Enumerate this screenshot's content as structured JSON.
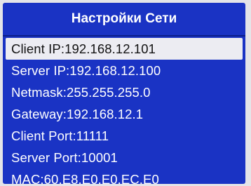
{
  "screen": {
    "title": "Настройки Сети"
  },
  "settings": [
    {
      "label": "Client IP",
      "value": "192.168.12.101",
      "selected": true
    },
    {
      "label": "Server IP",
      "value": "192.168.12.100",
      "selected": false
    },
    {
      "label": "Netmask",
      "value": "255.255.255.0",
      "selected": false
    },
    {
      "label": "Gateway",
      "value": "192.168.12.1",
      "selected": false
    },
    {
      "label": "Client Port",
      "value": "11111",
      "selected": false
    },
    {
      "label": "Server Port",
      "value": "10001",
      "selected": false
    },
    {
      "label": "MAC",
      "value": "60.E8.E0.E0.EC.E0",
      "selected": false
    }
  ],
  "colors": {
    "screen_background": "#1a33c4",
    "selection_background": "#ececf2",
    "text": "#ffffff",
    "selected_text": "#111111"
  }
}
